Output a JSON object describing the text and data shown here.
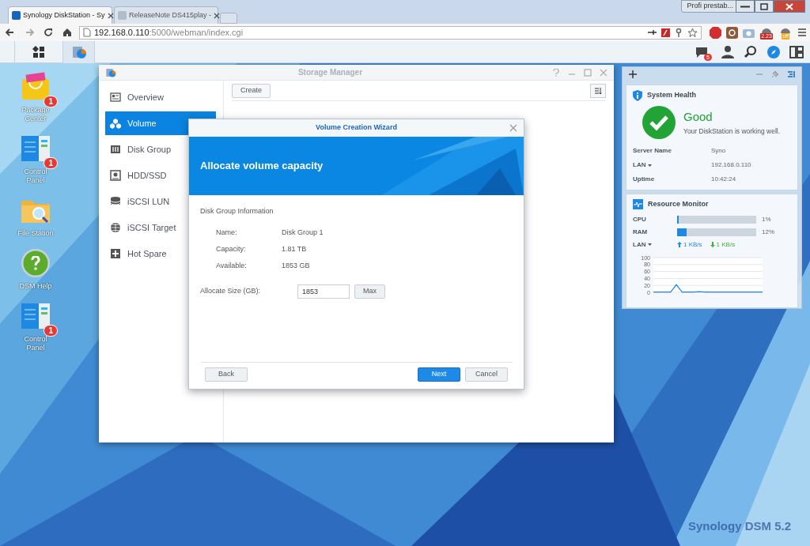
{
  "browser": {
    "tabs": [
      {
        "label": "Synology DiskStation - Sy",
        "selected": true
      },
      {
        "label": "ReleaseNote DS415play -",
        "selected": false
      }
    ],
    "profile": "Profi prestab...",
    "address": {
      "host": "192.168.0.110",
      "path": ":5000/webman/index.cgi"
    },
    "extension_badges": [
      "2.23",
      "off"
    ]
  },
  "taskbar": {
    "notification_count": "5"
  },
  "desktop": {
    "icons": [
      {
        "kind": "package",
        "label": "Package Center",
        "badge": "1"
      },
      {
        "kind": "panel",
        "label": "Control Panel",
        "badge": "1"
      },
      {
        "kind": "folder",
        "label": "File Station"
      },
      {
        "kind": "help",
        "label": "DSM Help"
      },
      {
        "kind": "panel",
        "label": "Control Panel",
        "badge": "1"
      }
    ],
    "wallpaper_logo": "Synology DSM 5.2"
  },
  "storage_manager": {
    "title": "Storage Manager",
    "sidebar": [
      {
        "kind": "overview",
        "label": "Overview",
        "selected": false
      },
      {
        "kind": "volume",
        "label": "Volume",
        "selected": true
      },
      {
        "kind": "diskgroup",
        "label": "Disk Group",
        "selected": false
      },
      {
        "kind": "hdd",
        "label": "HDD/SSD",
        "selected": false
      },
      {
        "kind": "lun",
        "label": "iSCSI LUN",
        "selected": false
      },
      {
        "kind": "target",
        "label": "iSCSI Target",
        "selected": false
      },
      {
        "kind": "spare",
        "label": "Hot Spare",
        "selected": false
      }
    ],
    "toolbar": [
      "Create"
    ]
  },
  "wizard": {
    "title": "Volume Creation Wizard",
    "heading": "Allocate volume capacity",
    "section": "Disk Group Information",
    "rows": [
      {
        "label": "Name:",
        "value": "Disk Group 1"
      },
      {
        "label": "Capacity:",
        "value": "1.81 TB"
      },
      {
        "label": "Available:",
        "value": "1853 GB"
      }
    ],
    "allocate": {
      "label": "Allocate Size (GB):",
      "value": "1853",
      "button": "Max"
    },
    "buttons": {
      "back": "Back",
      "next": "Next",
      "cancel": "Cancel"
    }
  },
  "widgets": {
    "system_health": {
      "title": "System Health",
      "status": "Good",
      "message": "Your DiskStation is working well.",
      "rows": [
        {
          "label": "Server Name",
          "value": "Syno",
          "dropdown": false
        },
        {
          "label": "LAN",
          "value": "192.168.0.110",
          "dropdown": true
        },
        {
          "label": "Uptime",
          "value": "10:42:24",
          "dropdown": false
        }
      ]
    },
    "resource_monitor": {
      "title": "Resource Monitor",
      "meters": [
        {
          "label": "CPU",
          "level": 0.01,
          "reading": "1%"
        },
        {
          "label": "RAM",
          "level": 0.12,
          "reading": "12%"
        }
      ],
      "lan_label": "LAN",
      "upload": "1 KB/s",
      "download": "1 KB/s",
      "chart_data": {
        "type": "line",
        "grid": true,
        "yticks": [
          0,
          20,
          40,
          60,
          80,
          100
        ],
        "ylim": [
          0,
          100
        ],
        "series": [
          {
            "color": "#1e88e5",
            "values": [
              1,
              1,
              1,
              1,
              22,
              1,
              1,
              1,
              2,
              1,
              1,
              1,
              1,
              1,
              1,
              1,
              1,
              1,
              1,
              1
            ]
          }
        ]
      }
    }
  }
}
